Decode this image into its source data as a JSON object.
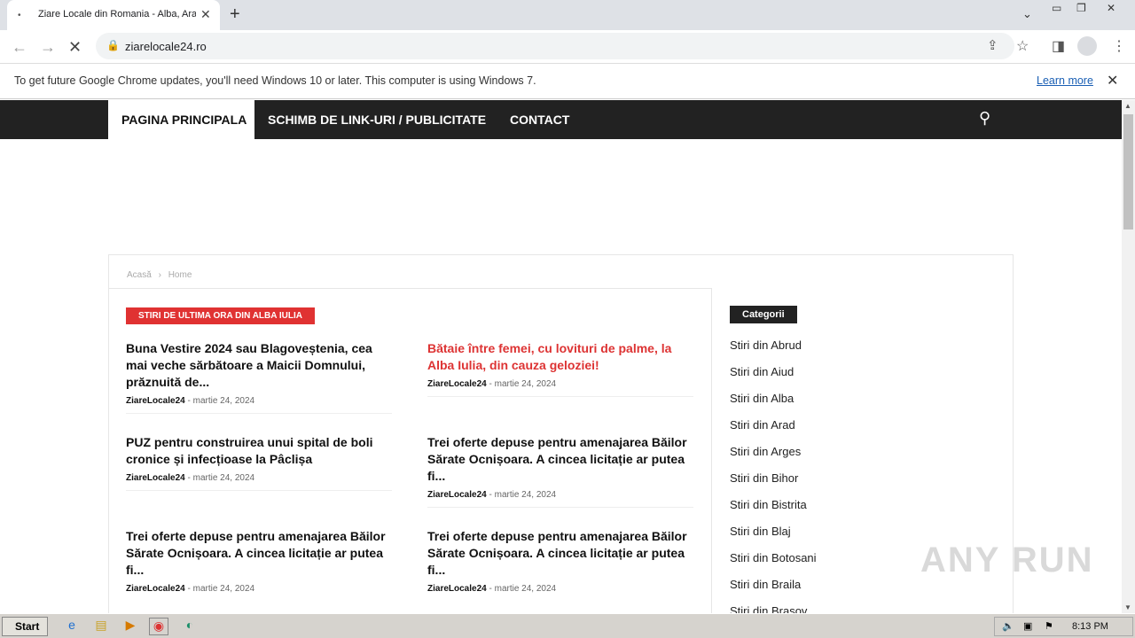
{
  "browser": {
    "tab_title": "Ziare Locale din Romania - Alba, Arad",
    "url": "ziarelocale24.ro",
    "icons": [
      "back-icon",
      "forward-icon",
      "stop-icon",
      "lock-icon",
      "share-icon",
      "star-icon",
      "sidepanel-icon",
      "profile-icon",
      "menu-icon"
    ]
  },
  "infobar": {
    "message": "To get future Google Chrome updates, you'll need Windows 10 or later. This computer is using Windows 7.",
    "link": "Learn more"
  },
  "menu": {
    "items": [
      "PAGINA PRINCIPALA",
      "SCHIMB DE LINK-URI / PUBLICITATE",
      "CONTACT"
    ]
  },
  "breadcrumb": {
    "home": "Acasă",
    "sep": "›",
    "current": "Home"
  },
  "section_label": "STIRI DE ULTIMA ORA DIN ALBA IULIA",
  "posts": [
    {
      "title": "Buna Vestire 2024 sau Blagoveștenia, cea mai veche sărbătoare a Maicii Domnului, prăznuită de...",
      "author": "ZiareLocale24",
      "date": "martie 24, 2024"
    },
    {
      "title": "Bătaie între femei, cu lovituri de palme, la Alba Iulia, din cauza geloziei!",
      "author": "ZiareLocale24",
      "date": "martie 24, 2024"
    },
    {
      "title": "PUZ pentru construirea unui spital de boli cronice și infecțioase la Pâclișa",
      "author": "ZiareLocale24",
      "date": "martie 24, 2024"
    },
    {
      "title": "Trei oferte depuse pentru amenajarea Băilor Sărate Ocnișoara. A cincea licitație ar putea fi...",
      "author": "ZiareLocale24",
      "date": "martie 24, 2024"
    },
    {
      "title": "Trei oferte depuse pentru amenajarea Băilor Sărate Ocnișoara. A cincea licitație ar putea fi...",
      "author": "ZiareLocale24",
      "date": "martie 24, 2024"
    },
    {
      "title": "Trei oferte depuse pentru amenajarea Băilor Sărate Ocnișoara. A cincea licitație ar putea fi...",
      "author": "ZiareLocale24",
      "date": "martie 24, 2024"
    }
  ],
  "sidebar": {
    "heading": "Categorii",
    "items": [
      "Stiri din Abrud",
      "Stiri din Aiud",
      "Stiri din Alba",
      "Stiri din Arad",
      "Stiri din Arges",
      "Stiri din Bihor",
      "Stiri din Bistrita",
      "Stiri din Blaj",
      "Stiri din Botosani",
      "Stiri din Braila",
      "Stiri din Brasov"
    ]
  },
  "watermark": "ANY RUN",
  "taskbar": {
    "start": "Start",
    "time": "8:13 PM"
  },
  "colors": {
    "accent": "#e03232",
    "menubar": "#222222"
  }
}
